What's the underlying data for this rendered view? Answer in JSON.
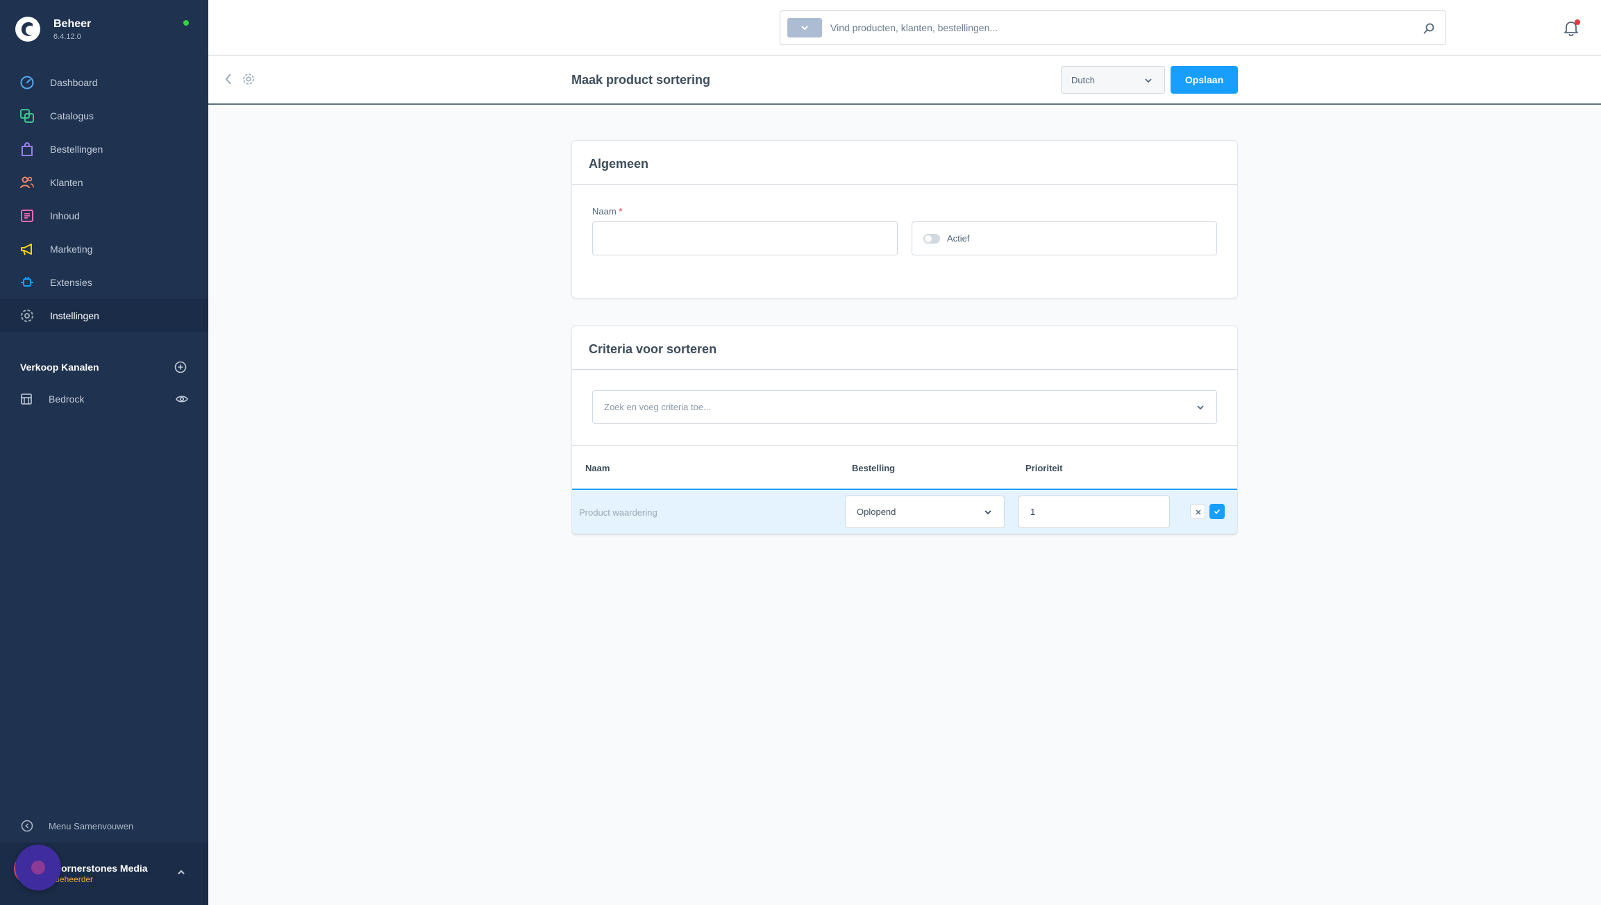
{
  "app": {
    "name": "Beheer",
    "version": "6.4.12.0"
  },
  "sidebar": {
    "items": [
      {
        "label": "Dashboard",
        "icon": "dashboard-icon",
        "color": "#54a8ee"
      },
      {
        "label": "Catalogus",
        "icon": "catalog-icon",
        "color": "#3fc28d"
      },
      {
        "label": "Bestellingen",
        "icon": "shopping-bag-icon",
        "color": "#9a7ff3"
      },
      {
        "label": "Klanten",
        "icon": "users-icon",
        "color": "#f88962"
      },
      {
        "label": "Inhoud",
        "icon": "content-icon",
        "color": "#ff68b4"
      },
      {
        "label": "Marketing",
        "icon": "megaphone-icon",
        "color": "#ffd700"
      },
      {
        "label": "Extensies",
        "icon": "plug-icon",
        "color": "#189eff"
      },
      {
        "label": "Instellingen",
        "icon": "gear-icon",
        "color": "#9aa8b5",
        "active": true
      }
    ],
    "sales_channels_title": "Verkoop Kanalen",
    "sales_channels": [
      {
        "label": "Bedrock",
        "icon": "storefront-icon"
      }
    ],
    "collapse_label": "Menu Samenvouwen",
    "user": {
      "name": "Cornerstones Media",
      "role": "Beheerder"
    }
  },
  "search": {
    "placeholder": "Vind producten, klanten, bestellingen..."
  },
  "header": {
    "title": "Maak product sortering",
    "language": "Dutch",
    "save_label": "Opslaan"
  },
  "general": {
    "title": "Algemeen",
    "name_label": "Naam",
    "name_required_mark": "*",
    "name_value": "",
    "active_label": "Actief",
    "active": false
  },
  "criteria": {
    "title": "Criteria voor sorteren",
    "search_placeholder": "Zoek en voeg criteria toe...",
    "columns": [
      "Naam",
      "Bestelling",
      "Prioriteit"
    ],
    "rows": [
      {
        "name": "Product waardering",
        "order": "Oplopend",
        "priority": "1"
      }
    ]
  },
  "colors": {
    "sidebar_bg": "#1f3250",
    "accent": "#189eff",
    "status_online": "#37d046",
    "notification": "#e03a3a",
    "role": "#f0a63a"
  }
}
